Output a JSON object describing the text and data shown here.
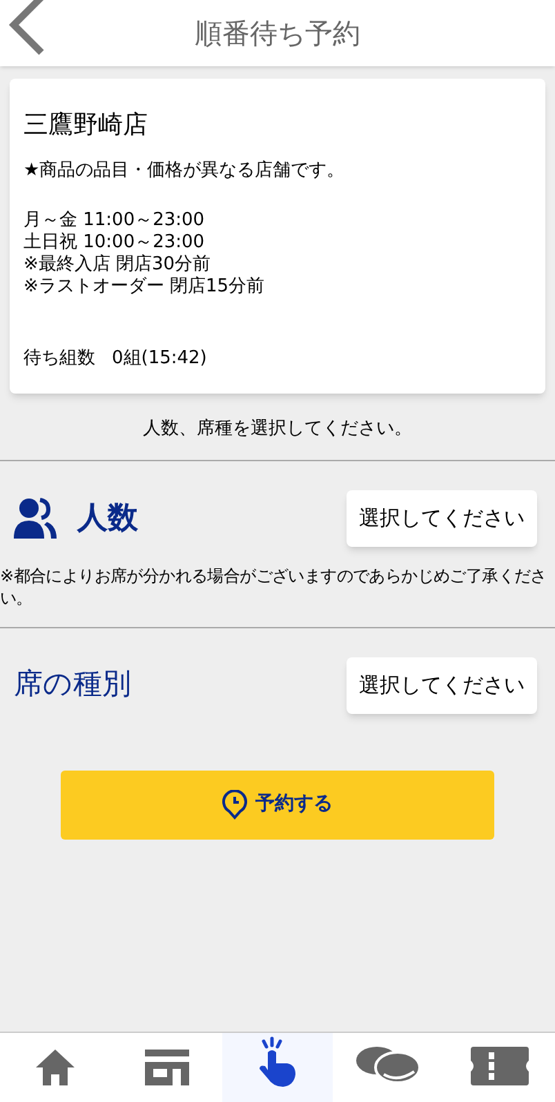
{
  "header": {
    "title": "順番待ち予約"
  },
  "store": {
    "name": "三鷹野崎店",
    "notice": "★商品の品目・価格が異なる店舗です。",
    "hours": [
      "月～金 11:00～23:00",
      "土日祝 10:00～23:00",
      "※最終入店 閉店30分前",
      "※ラストオーダー 閉店15分前"
    ],
    "waiting_label": "待ち組数",
    "waiting_value": "0組(15:42)"
  },
  "instruction": "人数、席種を選択してください。",
  "party_size": {
    "label": "人数",
    "select_placeholder": "選択してください",
    "note": "※都合によりお席が分かれる場合がございますのであらかじめご了承ください。"
  },
  "seat_type": {
    "label": "席の種別",
    "select_placeholder": "選択してください"
  },
  "reserve_button": "予約する",
  "bottom_nav": [
    {
      "kind": "home",
      "selected": false
    },
    {
      "kind": "store",
      "selected": false
    },
    {
      "kind": "reserve",
      "selected": true
    },
    {
      "kind": "menu",
      "selected": false
    },
    {
      "kind": "coupon",
      "selected": false
    }
  ]
}
